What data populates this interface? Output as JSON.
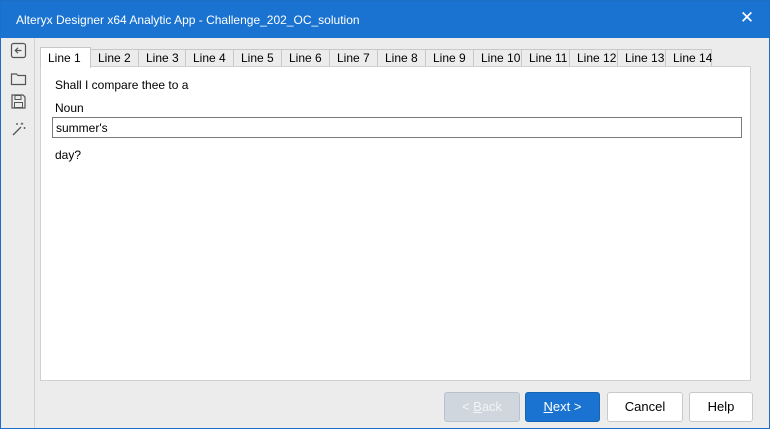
{
  "window": {
    "title": "Alteryx Designer x64 Analytic App - Challenge_202_OC_solution",
    "close_glyph": "✕"
  },
  "sidebar": {
    "icons": [
      "back-arrow-icon",
      "folder-open-icon",
      "save-icon",
      "magic-wand-icon"
    ]
  },
  "tabs": [
    "Line 1",
    "Line 2",
    "Line 3",
    "Line 4",
    "Line 5",
    "Line 6",
    "Line 7",
    "Line 8",
    "Line 9",
    "Line 10",
    "Line 11",
    "Line 12",
    "Line 13",
    "Line 14"
  ],
  "active_tab": "Line 1",
  "form": {
    "prompt": "Shall I compare thee to a",
    "field_label": "Noun",
    "field_value": "summer's",
    "suffix": "day?"
  },
  "buttons": {
    "back_prefix": "< ",
    "back_mnemonic": "B",
    "back_rest": "ack",
    "next_mnemonic": "N",
    "next_rest": "ext >",
    "cancel": "Cancel",
    "help": "Help"
  },
  "colors": {
    "accent": "#1a73d0",
    "disabled": "#cfd6de"
  }
}
